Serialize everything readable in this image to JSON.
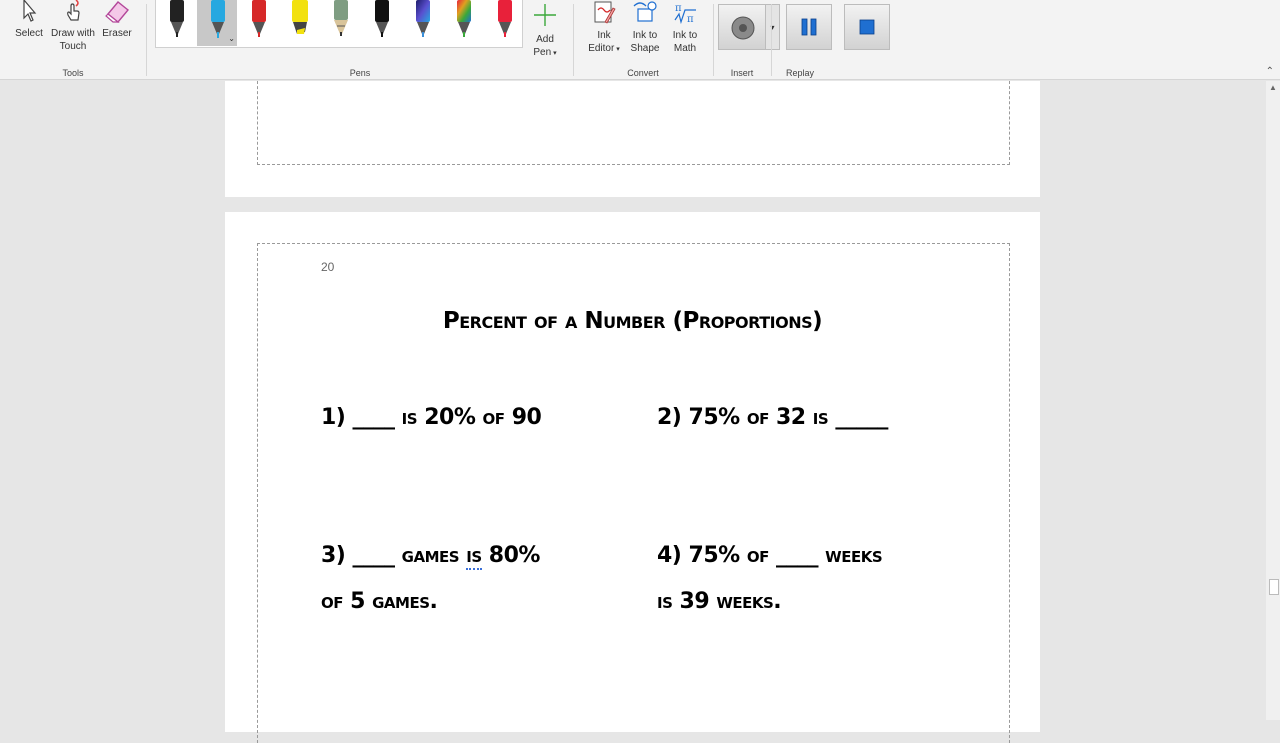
{
  "ribbon": {
    "tools": {
      "label": "Tools",
      "select": "Select",
      "draw_touch_l1": "Draw with",
      "draw_touch_l2": "Touch",
      "eraser": "Eraser"
    },
    "pens": {
      "label": "Pens",
      "add_pen_l1": "Add",
      "add_pen_l2": "Pen",
      "items": [
        {
          "color": "#222222",
          "kind": "pen"
        },
        {
          "color": "#27a8e0",
          "kind": "pen",
          "selected": true
        },
        {
          "color": "#d62828",
          "kind": "pen"
        },
        {
          "color": "#f2e10f",
          "kind": "highlighter"
        },
        {
          "color": "#7f9d82",
          "kind": "pencil"
        },
        {
          "color": "#111111",
          "kind": "pen"
        },
        {
          "color": "#5a4fcf",
          "kind": "galaxy"
        },
        {
          "color": "#e0a020",
          "kind": "rainbow"
        },
        {
          "color": "#e8213a",
          "kind": "pen"
        }
      ]
    },
    "convert": {
      "label": "Convert",
      "ink_editor_l1": "Ink",
      "ink_editor_l2": "Editor",
      "ink_shape_l1": "Ink to",
      "ink_shape_l2": "Shape",
      "ink_math_l1": "Ink to",
      "ink_math_l2": "Math"
    },
    "insert": {
      "label": "Insert"
    },
    "replay": {
      "label": "Replay"
    }
  },
  "document": {
    "page_number": "20",
    "heading": "Percent of a Number (Proportions)",
    "problems": {
      "p1": "1) ____ is 20% of 90",
      "p2": "2) 75% of 32 is _____",
      "p3_pre": "3) ____ games ",
      "p3_word": "is",
      "p3_post": " 80%",
      "p3_line2": "of 5 games.",
      "p4_line1": "4) 75% of ____ weeks",
      "p4_line2": "is 39 weeks."
    }
  },
  "colors": {
    "accent_green": "#3aa83a",
    "accent_blue": "#1f6fd1"
  }
}
